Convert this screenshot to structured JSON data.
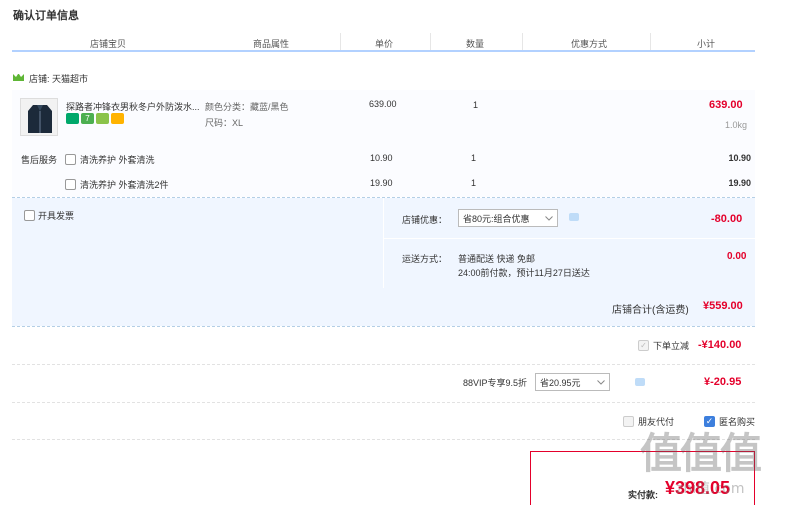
{
  "page": {
    "title": "确认订单信息"
  },
  "table_header": {
    "col_item": "店铺宝贝",
    "col_attr": "商品属性",
    "col_price": "单价",
    "col_qty": "数量",
    "col_promo": "优惠方式",
    "col_subtotal": "小计"
  },
  "shop": {
    "label": "店铺: 天猫超市"
  },
  "product": {
    "name": "探路者冲锋衣男秋冬户外防泼水...",
    "color": "颜色分类：藏蓝/黑色",
    "size": "尺码：XL",
    "price": "639.00",
    "qty": "1",
    "subtotal": "639.00",
    "weight": "1.0kg"
  },
  "after_sales": {
    "label": "售后服务",
    "options": [
      {
        "label": "清洗养护 外套清洗",
        "price": "10.90",
        "qty": "1",
        "subtotal": "10.90"
      },
      {
        "label": "清洗养护 外套清洗2件",
        "price": "19.90",
        "qty": "1",
        "subtotal": "19.90"
      }
    ]
  },
  "invoice": {
    "label": "开具发票"
  },
  "shop_discount": {
    "label": "店铺优惠：",
    "select": "省80元:组合优惠",
    "amount": "-80.00"
  },
  "shipping": {
    "label": "运送方式：",
    "method": "普通配送 快递 免邮",
    "eta": "24:00前付款，预计11月27日送达",
    "amount": "0.00"
  },
  "shop_total": {
    "label": "店铺合计(含运费)",
    "amount": "¥559.00"
  },
  "order_discount": {
    "label": "下单立减",
    "amount": "-¥140.00"
  },
  "vip": {
    "label": "88VIP专享9.5折",
    "select": "省20.95元",
    "amount": "¥-20.95"
  },
  "options": {
    "friend_pay": "朋友代付",
    "anonymous": "匿名购买"
  },
  "final": {
    "label": "实付款:",
    "amount": "¥398.05"
  },
  "watermark": {
    "main": "值值值",
    "sub": "zhi值.com"
  }
}
